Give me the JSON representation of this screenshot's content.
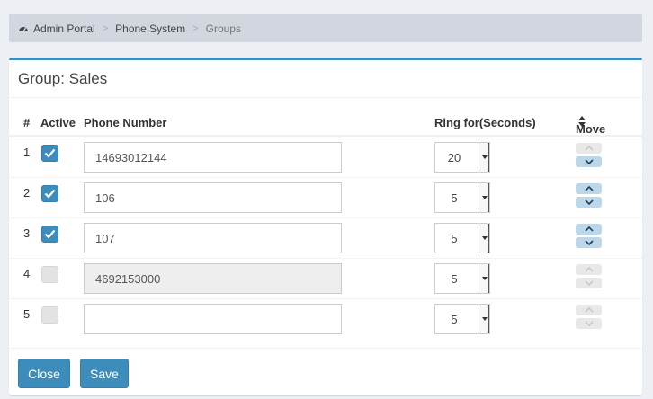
{
  "breadcrumb": {
    "items": [
      {
        "label": "Admin Portal",
        "icon": "dashboard-icon"
      },
      {
        "label": "Phone System"
      },
      {
        "label": "Groups"
      }
    ],
    "separator": ">"
  },
  "box": {
    "title": "Group: Sales"
  },
  "table": {
    "headers": {
      "num": "#",
      "active": "Active",
      "phone": "Phone Number",
      "ring": "Ring for(Seconds)",
      "move": "Move"
    },
    "rows": [
      {
        "num": "1",
        "active": true,
        "phone": "14693012144",
        "ring": "20",
        "up_enabled": false,
        "down_enabled": true,
        "phone_disabled": false
      },
      {
        "num": "2",
        "active": true,
        "phone": "106",
        "ring": "5",
        "up_enabled": true,
        "down_enabled": true,
        "phone_disabled": false
      },
      {
        "num": "3",
        "active": true,
        "phone": "107",
        "ring": "5",
        "up_enabled": true,
        "down_enabled": true,
        "phone_disabled": false
      },
      {
        "num": "4",
        "active": false,
        "phone": "4692153000",
        "ring": "5",
        "up_enabled": false,
        "down_enabled": false,
        "phone_disabled": true
      },
      {
        "num": "5",
        "active": false,
        "phone": "",
        "ring": "5",
        "up_enabled": false,
        "down_enabled": false,
        "phone_disabled": false
      }
    ]
  },
  "footer": {
    "close_label": "Close",
    "save_label": "Save"
  },
  "colors": {
    "primary": "#3c8dbc",
    "header_accent": "#3c8dbc",
    "move_enabled": "#bdd7ea",
    "move_disabled": "#e8e8e8"
  }
}
